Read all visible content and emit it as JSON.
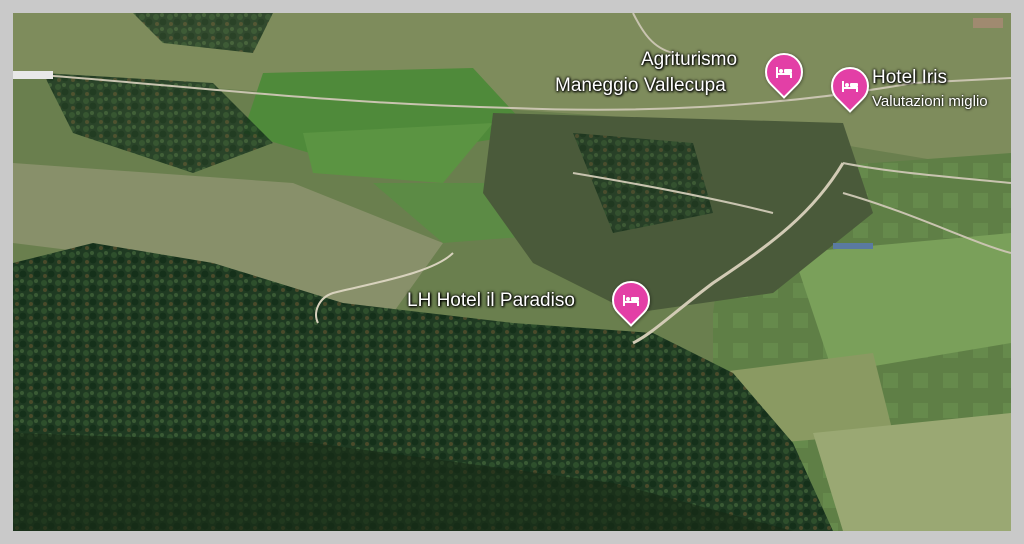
{
  "map": {
    "pois": [
      {
        "line1": "Agriturismo",
        "line2": "Maneggio Vallecupa",
        "icon": "hotel-bed-icon",
        "color": "#e33fa6"
      },
      {
        "line1": "Hotel Iris",
        "subtitle": "Valutazioni miglio",
        "icon": "hotel-bed-icon",
        "color": "#e33fa6"
      },
      {
        "line1": "LH Hotel il Paradiso",
        "icon": "hotel-bed-icon",
        "color": "#e33fa6"
      }
    ]
  }
}
